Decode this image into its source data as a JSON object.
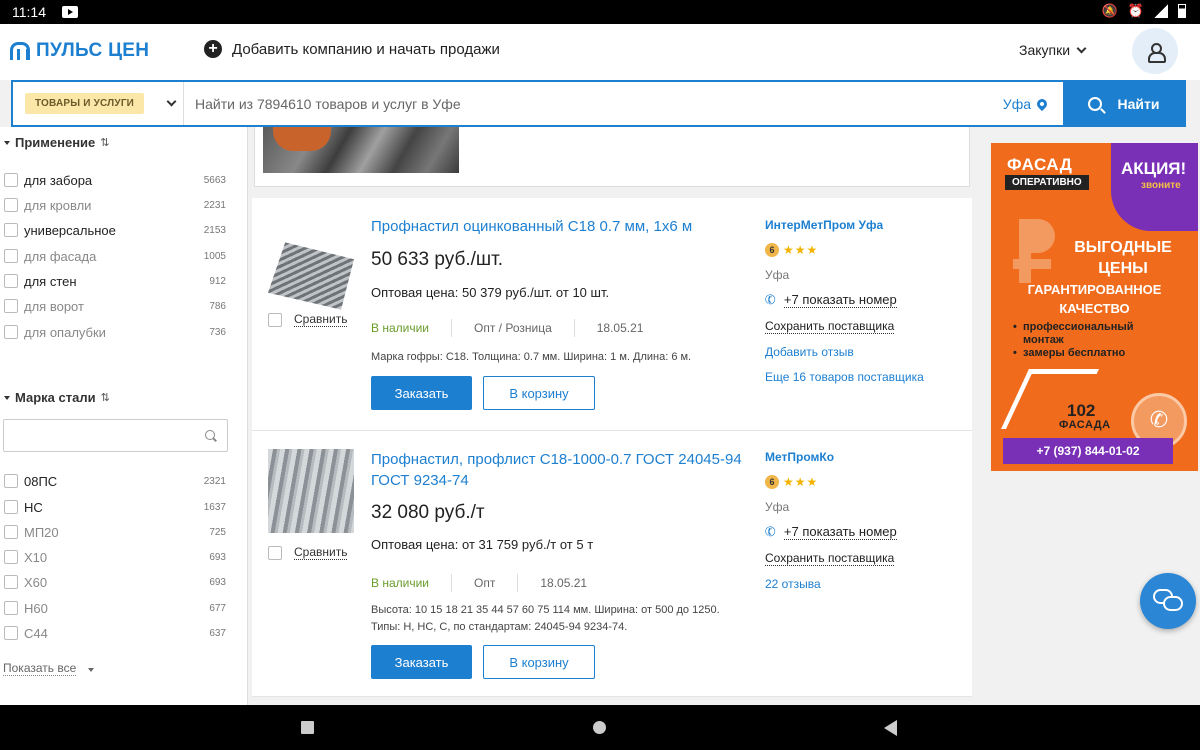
{
  "statusbar": {
    "time": "11:14"
  },
  "header": {
    "logo_text": "ПУЛЬС ЦЕН",
    "add_company": "Добавить компанию и начать продажи",
    "purchases": "Закупки"
  },
  "search": {
    "category": "ТОВАРЫ И УСЛУГИ",
    "placeholder": "Найти из 7894610 товаров и услуг в Уфе",
    "city": "Уфа",
    "button": "Найти"
  },
  "sidebar": {
    "application": {
      "title": "Применение",
      "items": [
        {
          "label": "для забора",
          "count": "5663",
          "dim": false
        },
        {
          "label": "для кровли",
          "count": "2231",
          "dim": true
        },
        {
          "label": "универсальное",
          "count": "2153",
          "dim": false
        },
        {
          "label": "для фасада",
          "count": "1005",
          "dim": true
        },
        {
          "label": "для стен",
          "count": "912",
          "dim": false
        },
        {
          "label": "для ворот",
          "count": "786",
          "dim": true
        },
        {
          "label": "для опалубки",
          "count": "736",
          "dim": true
        }
      ]
    },
    "steel": {
      "title": "Марка стали",
      "items": [
        {
          "label": "08ПС",
          "count": "2321",
          "dim": false
        },
        {
          "label": "НС",
          "count": "1637",
          "dim": false
        },
        {
          "label": "МП20",
          "count": "725",
          "dim": true
        },
        {
          "label": "Х10",
          "count": "693",
          "dim": true
        },
        {
          "label": "Х60",
          "count": "693",
          "dim": true
        },
        {
          "label": "Н60",
          "count": "677",
          "dim": true
        },
        {
          "label": "С44",
          "count": "637",
          "dim": true
        }
      ],
      "show_all": "Показать все"
    }
  },
  "products": [
    {
      "title": "Профнастил оцинкованный С18 0.7 мм, 1х6 м",
      "price": "50 633 руб./шт.",
      "wholesale": "Оптовая цена: 50 379 руб./шт. от 10 шт.",
      "compare": "Сравнить",
      "availability": "В наличии",
      "sale_type": "Опт / Розница",
      "date": "18.05.21",
      "description": "Марка гофры: С18. Толщина: 0.7 мм. Ширина: 1 м. Длина: 6 м.",
      "order_btn": "Заказать",
      "cart_btn": "В корзину",
      "supplier": "ИнтерМетПром Уфа",
      "badge": "6",
      "stars": "★★★",
      "city": "Уфа",
      "phone": "+7 показать номер",
      "save_supplier": "Сохранить поставщика",
      "link1": "Добавить отзыв",
      "link2": "Еще 16 товаров поставщика"
    },
    {
      "title": "Профнастил, профлист С18-1000-0.7 ГОСТ 24045-94 ГОСТ 9234-74",
      "price": "32 080 руб./т",
      "wholesale": "Оптовая цена: от 31 759 руб./т от 5 т",
      "compare": "Сравнить",
      "availability": "В наличии",
      "sale_type": "Опт",
      "date": "18.05.21",
      "description_1": "Высота: 10 15 18 21 35 44 57 60 75 114 мм. Ширина: от 500 до 1250.",
      "description_2": "Типы: Н, НС, С, по стандартам: 24045-94 9234-74.",
      "order_btn": "Заказать",
      "cart_btn": "В корзину",
      "supplier": "МетПромКо",
      "badge": "6",
      "stars": "★★★",
      "city": "Уфа",
      "phone": "+7 показать номер",
      "save_supplier": "Сохранить поставщика",
      "link1": "22 отзыва"
    }
  ],
  "ad": {
    "fasad": "ФАСАД",
    "operativno": "ОПЕРАТИВНО",
    "akcia": "АКЦИЯ!",
    "zvonite": "звоните",
    "big_1": "ВЫГОДНЫЕ",
    "big_2": "ЦЕНЫ",
    "mid_1": "ГАРАНТИРОВАННОЕ",
    "mid_2": "КАЧЕСТВО",
    "list_1": "профессиональный",
    "list_1b": "монтаж",
    "list_2": "замеры бесплатно",
    "num": "102",
    "fasada": "ФАСАДА",
    "phone": "+7 (937) 844-01-02",
    "colors": {
      "orange": "#f06b1b",
      "purple": "#7a2fb7"
    }
  },
  "colors": {
    "brand": "#1d7fd0",
    "available": "#6a9c2d",
    "star": "#f5b301"
  }
}
